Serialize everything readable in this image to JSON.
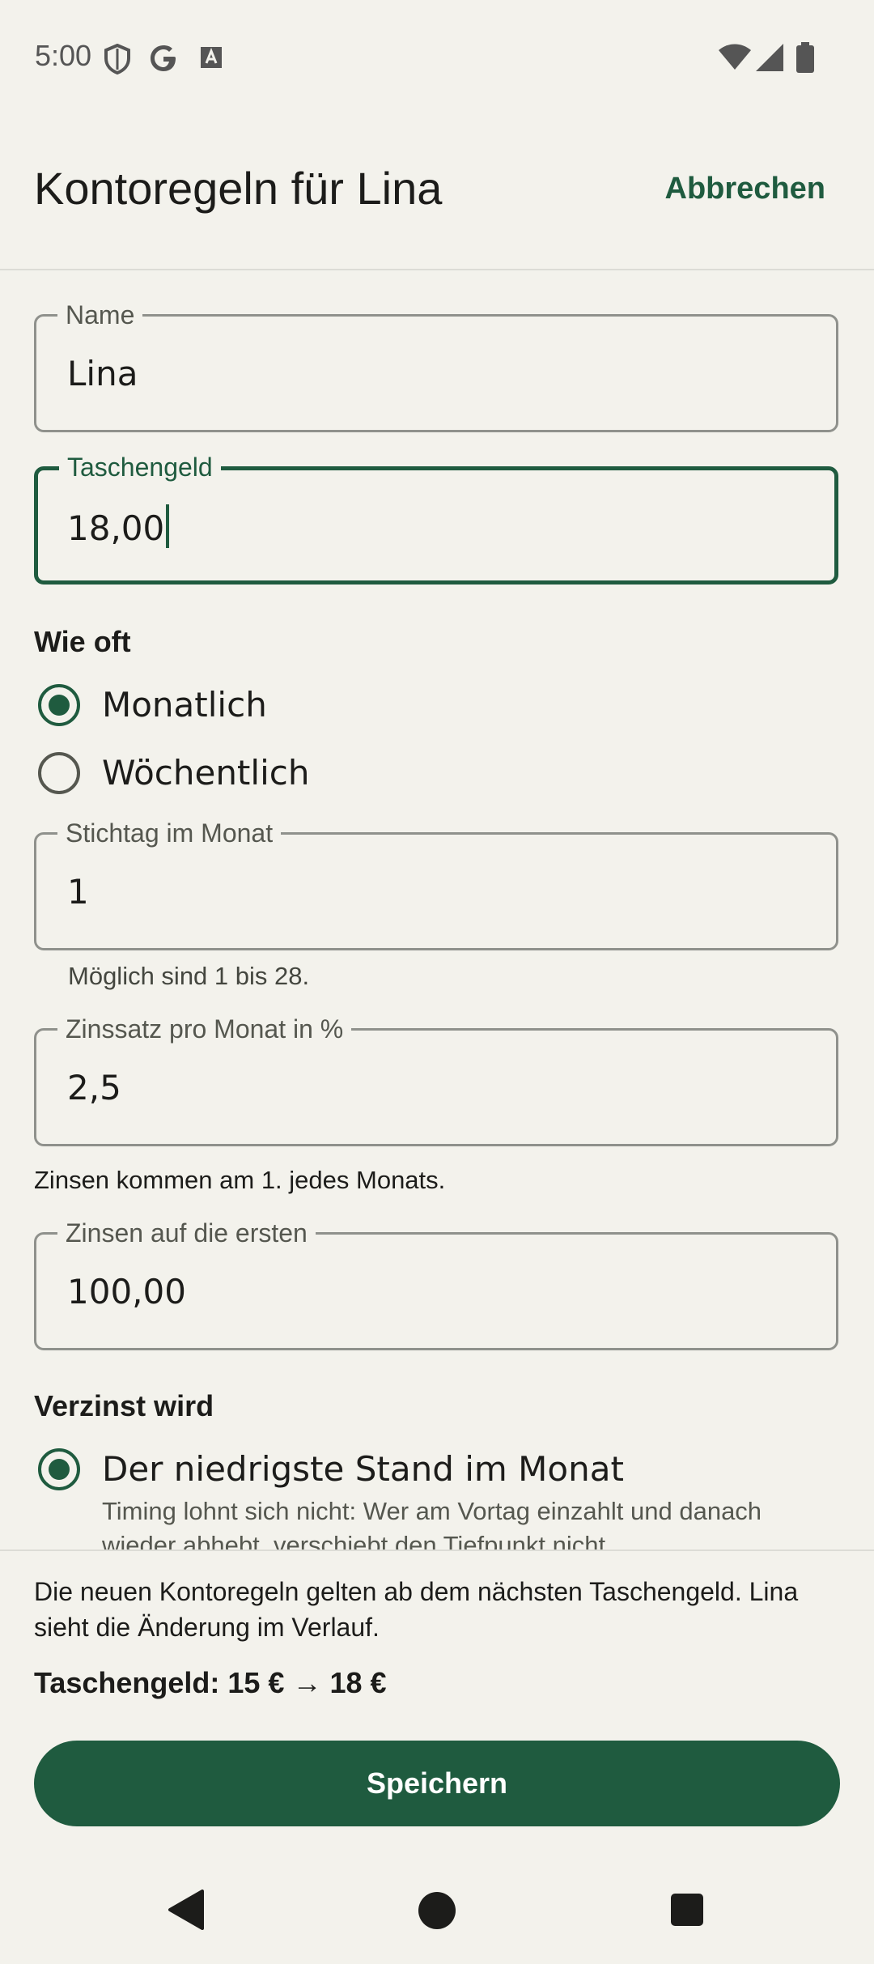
{
  "status_bar": {
    "time": "5:00",
    "icons": [
      "shield-icon",
      "google-icon",
      "font-icon",
      "wifi-icon",
      "signal-icon",
      "battery-icon"
    ]
  },
  "header": {
    "title": "Kontoregeln für Lina",
    "cancel_label": "Abbrechen"
  },
  "form": {
    "name": {
      "label": "Name",
      "value": "Lina"
    },
    "allowance": {
      "label": "Taschengeld",
      "value": "18,00"
    },
    "frequency": {
      "section_label": "Wie oft",
      "options": [
        {
          "label": "Monatlich",
          "checked": true
        },
        {
          "label": "Wöchentlich",
          "checked": false
        }
      ]
    },
    "due_day": {
      "label": "Stichtag im Monat",
      "value": "1",
      "helper": "Möglich sind 1 bis 28."
    },
    "interest_rate": {
      "label": "Zinssatz pro Monat in %",
      "value": "2,5",
      "helper": "Zinsen kommen am 1. jedes Monats."
    },
    "interest_cap": {
      "label": "Zinsen auf die ersten",
      "value": "100,00"
    },
    "interest_basis": {
      "section_label": "Verzinst wird",
      "options": [
        {
          "label": "Der niedrigste Stand im Monat",
          "checked": true,
          "description": "Timing lohnt sich nicht: Wer am Vortag einzahlt und danach wieder abhebt, verschiebt den Tiefpunkt nicht."
        }
      ]
    }
  },
  "footer": {
    "notice": "Die neuen Kontoregeln gelten ab dem nächsten Taschengeld. Lina sieht die Änderung im Verlauf.",
    "summary": "Taschengeld: 15 € → 18 €",
    "save_label": "Speichern"
  },
  "nav_bar": {
    "icons": [
      "back-icon",
      "home-icon",
      "recents-icon"
    ]
  },
  "colors": {
    "accent": "#1f5b3f",
    "background": "#f3f2ec",
    "outline": "#8f918c"
  }
}
